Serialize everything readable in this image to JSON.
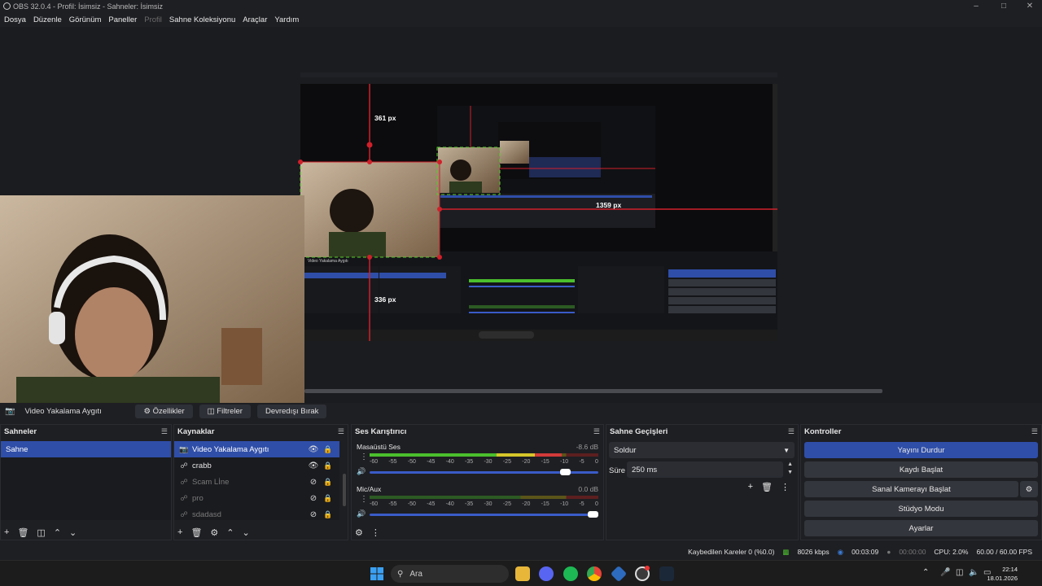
{
  "window": {
    "title": "OBS 32.0.4 - Profil: İsimsiz - Sahneler: İsimsiz"
  },
  "menu": [
    "Dosya",
    "Düzenle",
    "Görünüm",
    "Paneller",
    "Profil",
    "Sahne Koleksiyonu",
    "Araçlar",
    "Yardım"
  ],
  "preview": {
    "overlay_labels": {
      "top": "361 px",
      "left": "336 px",
      "right": "1359 px"
    },
    "inner_source_name": "Video Yakalama Aygıtı"
  },
  "source_toolbar": {
    "source_name": "Video Yakalama Aygıtı",
    "properties": "Özellikler",
    "filters": "Filtreler",
    "deactivate": "Devredışı Bırak"
  },
  "scenes": {
    "title": "Sahneler",
    "items": [
      "Sahne"
    ]
  },
  "sources": {
    "title": "Kaynaklar",
    "items": [
      {
        "name": "Video Yakalama Aygıtı",
        "icon": "camera-icon",
        "visible": true
      },
      {
        "name": "crabb",
        "icon": "link-icon",
        "visible": true
      },
      {
        "name": "Scam Lİne",
        "icon": "link-icon",
        "visible": false
      },
      {
        "name": "pro",
        "icon": "link-icon",
        "visible": false
      },
      {
        "name": "sdadasd",
        "icon": "link-icon",
        "visible": false
      }
    ]
  },
  "mixer": {
    "title": "Ses Karıştırıcı",
    "ticks": [
      "-60",
      "-55",
      "-50",
      "-45",
      "-40",
      "-35",
      "-30",
      "-25",
      "-20",
      "-15",
      "-10",
      "-5",
      "0"
    ],
    "channels": [
      {
        "name": "Masaüstü Ses",
        "db": "-8.6 dB",
        "level": 0.84,
        "volume": 0.88
      },
      {
        "name": "Mic/Aux",
        "db": "0.0 dB",
        "level": 0.0,
        "volume": 1.0
      }
    ]
  },
  "transitions": {
    "title": "Sahne Geçişleri",
    "selected": "Soldur",
    "duration_label": "Süre",
    "duration": "250 ms"
  },
  "controls": {
    "title": "Kontroller",
    "stop_stream": "Yayını Durdur",
    "start_record": "Kaydı Başlat",
    "start_virtual_cam": "Sanal Kamerayı Başlat",
    "studio_mode": "Stüdyo Modu",
    "settings": "Ayarlar"
  },
  "status": {
    "dropped": "Kaybedilen Kareler 0 (%0.0)",
    "bitrate": "8026 kbps",
    "stream_time": "00:03:09",
    "rec_time": "00:00:00",
    "cpu": "CPU: 2.0%",
    "fps": "60.00 / 60.00 FPS"
  },
  "taskbar": {
    "search": "Ara",
    "time": "22:14",
    "date": "18.01.2026"
  },
  "colors": {
    "accent": "#2f4ea8",
    "guide": "#d0202a",
    "bg": "#1e1f23"
  }
}
